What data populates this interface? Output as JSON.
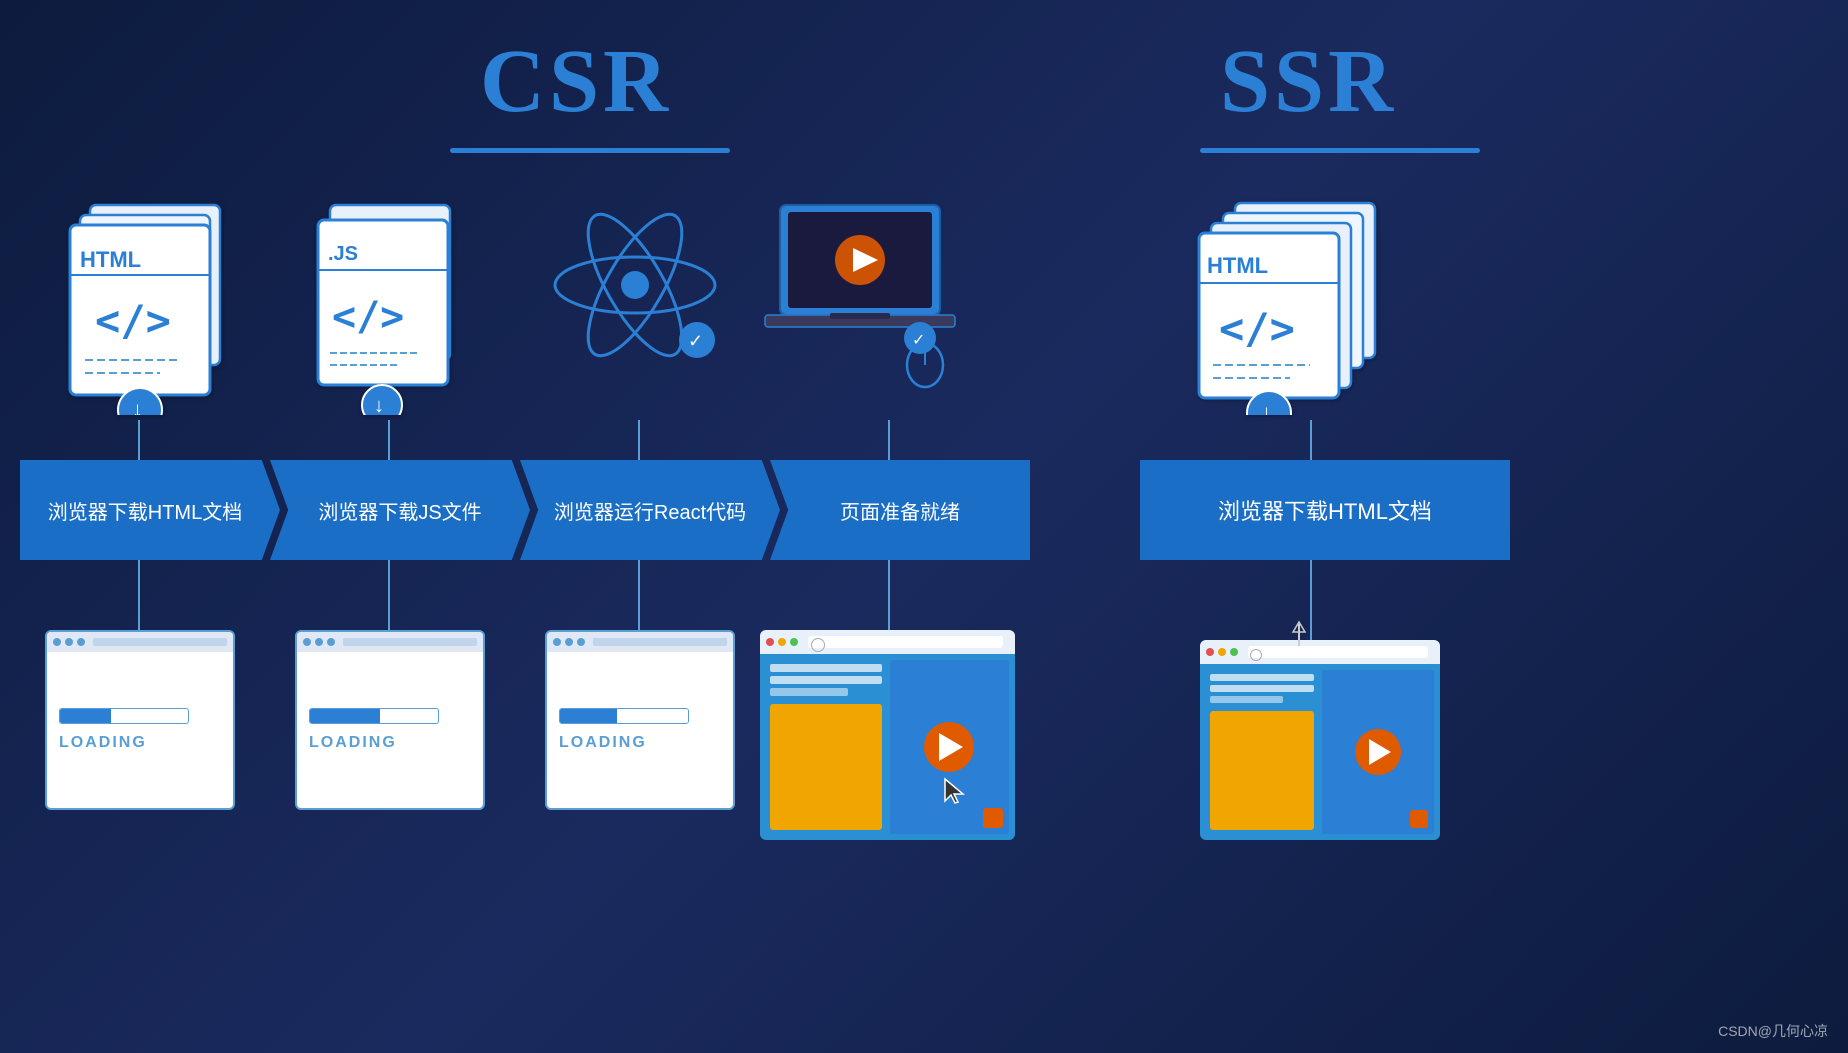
{
  "titles": {
    "csr": "CSR",
    "ssr": "SSR"
  },
  "csr_boxes": [
    {
      "label": "浏览器下载HTML文档"
    },
    {
      "label": "浏览器下载JS文件"
    },
    {
      "label": "浏览器运行React代码"
    },
    {
      "label": "页面准备就绪"
    }
  ],
  "ssr_boxes": [
    {
      "label": "浏览器下载HTML文档"
    }
  ],
  "loading_screens": [
    {
      "text": "LOADING",
      "fill_width": "40%"
    },
    {
      "text": "LOADING",
      "fill_width": "55%"
    },
    {
      "text": "LOADING",
      "fill_width": "45%"
    }
  ],
  "watermark": "CSDN@几何心凉"
}
